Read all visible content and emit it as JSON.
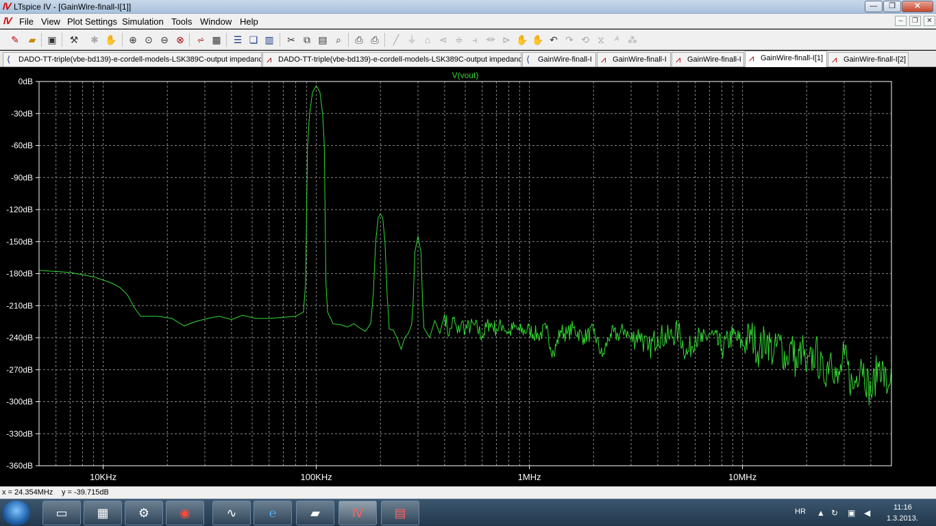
{
  "window": {
    "title": "LTspice IV - [GainWire-finall-I[1]]",
    "controls": {
      "minimize": "—",
      "maximize": "❐",
      "close": "✕"
    },
    "mdi_controls": {
      "minimize": "–",
      "restore": "❐",
      "close": "✕"
    }
  },
  "menu": {
    "items": [
      "File",
      "View",
      "Plot Settings",
      "Simulation",
      "Tools",
      "Window",
      "Help"
    ]
  },
  "toolbar": {
    "icons": [
      "open-schematic-icon",
      "open-file-icon",
      "save-icon",
      "hammer-icon",
      "run-icon",
      "pan-hand-icon",
      "zoom-in-icon",
      "zoom-fit-icon",
      "zoom-out-icon",
      "cancel-zoom-icon",
      "autoscale-icon",
      "grid-icon",
      "tile-horizontal-icon",
      "cascade-icon",
      "tile-vertical-icon",
      "cut-icon",
      "copy-icon",
      "paste-icon",
      "find-icon",
      "print-setup-icon",
      "print-icon",
      "wire-icon",
      "ground-icon",
      "label-icon",
      "component-icon",
      "resistor-icon",
      "capacitor-icon",
      "inductor-icon",
      "diode-icon",
      "move-icon",
      "drag-icon",
      "undo-icon",
      "redo-icon",
      "rotate-icon",
      "mirror-icon",
      "text-icon",
      "spice-directive-icon"
    ]
  },
  "tabs": [
    {
      "label": "DADO-TT-triple(vbe-bd139)-e-cordell-models-LSK389C-output impedance",
      "kind": "schematic"
    },
    {
      "label": "DADO-TT-triple(vbe-bd139)-e-cordell-models-LSK389C-output impedance",
      "kind": "waveform"
    },
    {
      "label": "GainWire-finall-I",
      "kind": "schematic"
    },
    {
      "label": "GainWire-finall-I",
      "kind": "waveform"
    },
    {
      "label": "GainWire-finall-I",
      "kind": "waveform"
    },
    {
      "label": "GainWire-finall-I[1]",
      "kind": "waveform",
      "active": true
    },
    {
      "label": "GainWire-finall-I[2]",
      "kind": "waveform"
    }
  ],
  "chart_data": {
    "type": "line",
    "title": "V(vout)",
    "xlabel": "",
    "ylabel": "",
    "x_scale": "log",
    "xlim": [
      5000,
      50000000
    ],
    "ylim": [
      -360,
      0
    ],
    "grid": true,
    "colors": {
      "trace": "#33dd33",
      "axis_text": "#ffffff",
      "grid": "#8a8a8a",
      "background": "#000000"
    },
    "y_ticks": [
      "0dB",
      "-30dB",
      "-60dB",
      "-90dB",
      "-120dB",
      "-150dB",
      "-180dB",
      "-210dB",
      "-240dB",
      "-270dB",
      "-300dB",
      "-330dB",
      "-360dB"
    ],
    "x_ticks": [
      {
        "value": 10000,
        "label": "10KHz"
      },
      {
        "value": 100000,
        "label": "100KHz"
      },
      {
        "value": 1000000,
        "label": "1MHz"
      },
      {
        "value": 10000000,
        "label": "10MHz"
      }
    ],
    "series": [
      {
        "name": "V(vout)",
        "points": [
          [
            5000,
            -177
          ],
          [
            6000,
            -178
          ],
          [
            7000,
            -179
          ],
          [
            8000,
            -181
          ],
          [
            9000,
            -183
          ],
          [
            10000,
            -186
          ],
          [
            11000,
            -189
          ],
          [
            12000,
            -193
          ],
          [
            13000,
            -200
          ],
          [
            14000,
            -212
          ],
          [
            15000,
            -220
          ],
          [
            18000,
            -220
          ],
          [
            21000,
            -222
          ],
          [
            24000,
            -229
          ],
          [
            27000,
            -225
          ],
          [
            31000,
            -222
          ],
          [
            35000,
            -220
          ],
          [
            40000,
            -223
          ],
          [
            45000,
            -219
          ],
          [
            52000,
            -222
          ],
          [
            60000,
            -222
          ],
          [
            70000,
            -221
          ],
          [
            80000,
            -220
          ],
          [
            87000,
            -216
          ],
          [
            89000,
            -190
          ],
          [
            91000,
            -60
          ],
          [
            93000,
            -30
          ],
          [
            96000,
            -10
          ],
          [
            100000,
            -4
          ],
          [
            104000,
            -10
          ],
          [
            107000,
            -30
          ],
          [
            109000,
            -60
          ],
          [
            111000,
            -190
          ],
          [
            113000,
            -216
          ],
          [
            120000,
            -227
          ],
          [
            130000,
            -228
          ],
          [
            140000,
            -230
          ],
          [
            150000,
            -227
          ],
          [
            160000,
            -231
          ],
          [
            170000,
            -234
          ],
          [
            180000,
            -227
          ],
          [
            185000,
            -200
          ],
          [
            190000,
            -150
          ],
          [
            195000,
            -128
          ],
          [
            200000,
            -124
          ],
          [
            205000,
            -128
          ],
          [
            210000,
            -150
          ],
          [
            215000,
            -200
          ],
          [
            220000,
            -232
          ],
          [
            230000,
            -233
          ],
          [
            240000,
            -241
          ],
          [
            250000,
            -251
          ],
          [
            260000,
            -240
          ],
          [
            270000,
            -236
          ],
          [
            280000,
            -228
          ],
          [
            285000,
            -205
          ],
          [
            290000,
            -160
          ],
          [
            300000,
            -145
          ],
          [
            310000,
            -160
          ],
          [
            315000,
            -205
          ],
          [
            320000,
            -231
          ],
          [
            340000,
            -240
          ],
          [
            360000,
            -224
          ],
          [
            380000,
            -236
          ],
          [
            400000,
            -218
          ],
          [
            420000,
            -238
          ],
          [
            440000,
            -222
          ],
          [
            460000,
            -236
          ],
          [
            480000,
            -226
          ],
          [
            500000,
            -232
          ],
          [
            550000,
            -228
          ],
          [
            600000,
            -238
          ],
          [
            650000,
            -226
          ],
          [
            700000,
            -232
          ],
          [
            750000,
            -228
          ],
          [
            800000,
            -236
          ],
          [
            850000,
            -230
          ],
          [
            900000,
            -234
          ],
          [
            1000000,
            -233
          ],
          [
            1100000,
            -238
          ],
          [
            1200000,
            -232
          ],
          [
            1300000,
            -256
          ],
          [
            1400000,
            -233
          ],
          [
            1500000,
            -237
          ],
          [
            1600000,
            -231
          ],
          [
            1800000,
            -240
          ],
          [
            2000000,
            -234
          ],
          [
            2200000,
            -258
          ],
          [
            2400000,
            -236
          ],
          [
            2600000,
            -238
          ],
          [
            2800000,
            -232
          ],
          [
            3000000,
            -242
          ],
          [
            3300000,
            -236
          ],
          [
            3600000,
            -252
          ],
          [
            4000000,
            -238
          ],
          [
            4500000,
            -240
          ],
          [
            5000000,
            -234
          ],
          [
            5500000,
            -256
          ],
          [
            6000000,
            -238
          ],
          [
            6500000,
            -244
          ],
          [
            7000000,
            -236
          ],
          [
            8000000,
            -250
          ],
          [
            9000000,
            -238
          ],
          [
            10000000,
            -246
          ],
          [
            11000000,
            -238
          ],
          [
            12000000,
            -252
          ],
          [
            13000000,
            -240
          ],
          [
            14000000,
            -256
          ],
          [
            15000000,
            -243
          ],
          [
            16000000,
            -262
          ],
          [
            17000000,
            -246
          ],
          [
            18000000,
            -268
          ],
          [
            19000000,
            -248
          ],
          [
            20000000,
            -272
          ],
          [
            22000000,
            -252
          ],
          [
            24000000,
            -277
          ],
          [
            26000000,
            -254
          ],
          [
            28000000,
            -283
          ],
          [
            30000000,
            -257
          ],
          [
            33000000,
            -288
          ],
          [
            36000000,
            -260
          ],
          [
            40000000,
            -293
          ],
          [
            44000000,
            -262
          ],
          [
            48000000,
            -289
          ],
          [
            50000000,
            -266
          ]
        ]
      }
    ]
  },
  "status": {
    "x_readout": "x = 24.354MHz",
    "y_readout": "y = -39.715dB"
  },
  "taskbar": {
    "buttons": [
      "file-explorer-icon",
      "installer-icon",
      "scanner-icon",
      "antivirus-icon",
      "oscilloscope-icon",
      "internet-explorer-icon",
      "folder-icon",
      "ltspice-icon",
      "pdf-reader-icon"
    ],
    "language": "HR",
    "time": "11:16",
    "date": "1.3.2013."
  }
}
